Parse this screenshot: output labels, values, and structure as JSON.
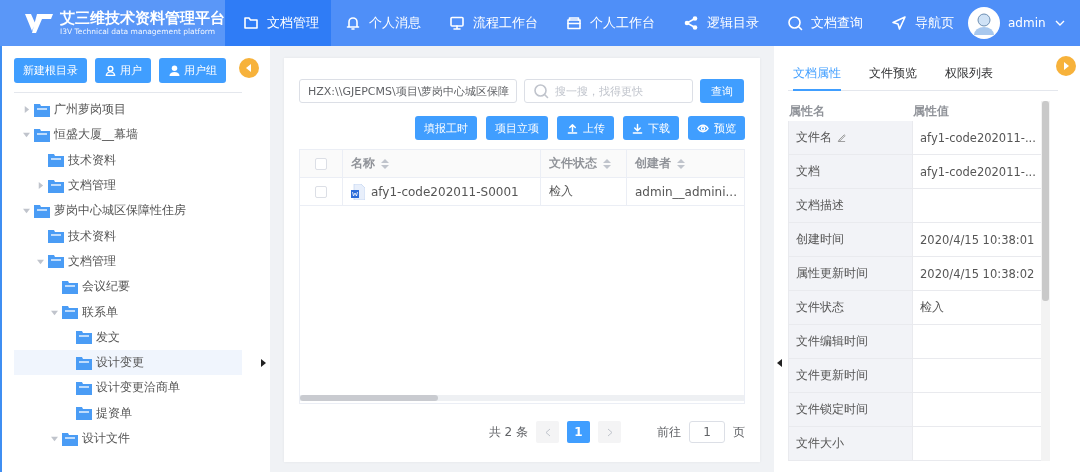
{
  "header": {
    "title": "艾三维技术资料管理平台",
    "subtitle": "I3V Technical data management platform",
    "nav": [
      {
        "label": "文档管理",
        "selected": true
      },
      {
        "label": "个人消息",
        "selected": false
      },
      {
        "label": "流程工作台",
        "selected": false
      },
      {
        "label": "个人工作台",
        "selected": false
      },
      {
        "label": "逻辑目录",
        "selected": false
      },
      {
        "label": "文档查询",
        "selected": false
      },
      {
        "label": "导航页",
        "selected": false
      }
    ],
    "user": "admin"
  },
  "sidebar": {
    "buttons": [
      "新建根目录",
      "用户",
      "用户组"
    ],
    "tree": [
      {
        "label": "广州萝岗项目",
        "expanded": false,
        "selected": false
      },
      {
        "label": "恒盛大厦__幕墙",
        "expanded": true,
        "selected": false,
        "children": [
          {
            "label": "技术资料",
            "selected": false
          },
          {
            "label": "文档管理",
            "expanded": false,
            "selected": false
          }
        ]
      },
      {
        "label": "萝岗中心城区保障性住房",
        "expanded": true,
        "selected": false,
        "children": [
          {
            "label": "技术资料",
            "selected": false
          },
          {
            "label": "文档管理",
            "expanded": true,
            "selected": false,
            "children": [
              {
                "label": "会议纪要",
                "selected": false
              },
              {
                "label": "联系单",
                "expanded": true,
                "selected": false,
                "children": [
                  {
                    "label": "发文",
                    "selected": false
                  },
                  {
                    "label": "设计变更",
                    "selected": true
                  },
                  {
                    "label": "设计变更洽商单",
                    "selected": false
                  },
                  {
                    "label": "提资单",
                    "selected": false
                  }
                ]
              },
              {
                "label": "设计文件",
                "expanded": true,
                "selected": false
              }
            ]
          }
        ]
      }
    ]
  },
  "files": {
    "path": "HZX:\\\\GJEPCMS\\项目\\萝岗中心城区保障",
    "search_placeholder": "搜一搜，找得更快",
    "search_button": "查询",
    "actions": [
      "填报工时",
      "项目立项",
      "上传",
      "下载",
      "预览"
    ],
    "table": {
      "select_all_checked": false,
      "columns": [
        "名称",
        "文件状态",
        "创建者"
      ],
      "rows": [
        {
          "checked": false,
          "name": "afy1-code202011-S0001",
          "status": "检入",
          "creator": "admin__admini..."
        }
      ]
    },
    "pagination": {
      "total": "共 2 条",
      "pages": [
        {
          "label": "1",
          "selected": true
        }
      ],
      "goto_label": "前往",
      "goto_value": "1",
      "page_suffix": "页"
    }
  },
  "properties": {
    "tabs": [
      {
        "label": "文档属性",
        "selected": true
      },
      {
        "label": "文件预览",
        "selected": false
      },
      {
        "label": "权限列表",
        "selected": false
      }
    ],
    "columns": [
      "属性名",
      "属性值"
    ],
    "rows": [
      {
        "name": "文件名",
        "editable": true,
        "value": "afy1-code202011-..."
      },
      {
        "name": "文档",
        "editable": false,
        "value": "afy1-code202011-..."
      },
      {
        "name": "文档描述",
        "editable": false
      },
      {
        "name": "创建时间",
        "editable": false,
        "value": "2020/4/15 10:38:01"
      },
      {
        "name": "属性更新时间",
        "editable": false,
        "value": "2020/4/15 10:38:02"
      },
      {
        "name": "文件状态",
        "editable": false,
        "value": "检入"
      },
      {
        "name": "文件编辑时间",
        "editable": false
      },
      {
        "name": "文件更新时间",
        "editable": false
      },
      {
        "name": "文件锁定时间",
        "editable": false
      },
      {
        "name": "文件大小",
        "editable": false
      }
    ]
  }
}
